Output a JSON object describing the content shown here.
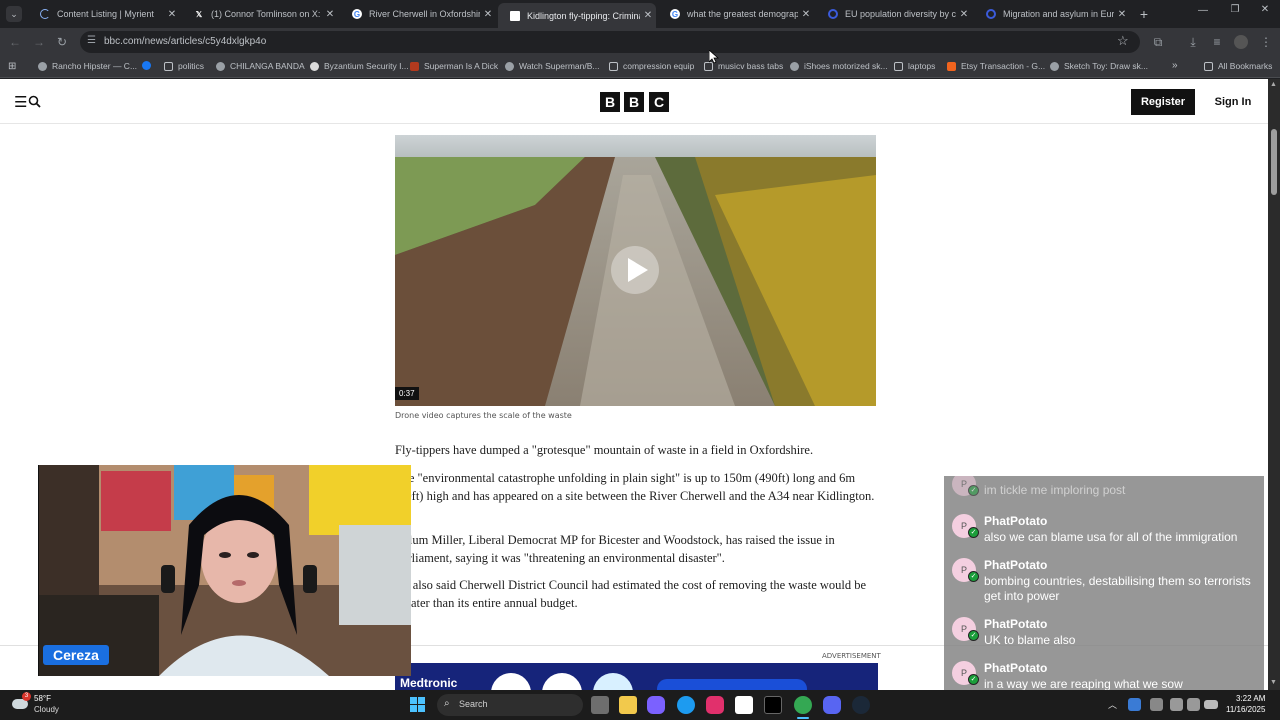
{
  "browser": {
    "tabs": [
      {
        "label": "Content Listing | Myrient"
      },
      {
        "label": "(1) Connor Tomlinson on X: \"A"
      },
      {
        "label": "River Cherwell in Oxfordshire"
      },
      {
        "label": "Kidlington fly-tipping: Criminal"
      },
      {
        "label": "what the greatest demographi"
      },
      {
        "label": "EU population diversity by citi"
      },
      {
        "label": "Migration and asylum in Europ"
      }
    ],
    "url": "bbc.com/news/articles/c5y4dxlgkp4o",
    "bookmarks": [
      {
        "label": "Rancho Hipster — C..."
      },
      {
        "label": ""
      },
      {
        "label": "politics"
      },
      {
        "label": "CHILANGA BANDA"
      },
      {
        "label": "Byzantium Security I..."
      },
      {
        "label": "Superman Is A Dick"
      },
      {
        "label": "Watch Superman/B..."
      },
      {
        "label": "compression equip"
      },
      {
        "label": "musicv bass tabs"
      },
      {
        "label": "iShoes motorized sk..."
      },
      {
        "label": "laptops"
      },
      {
        "label": "Etsy Transaction - G..."
      },
      {
        "label": "Sketch Toy: Draw sk..."
      },
      {
        "label": "All Bookmarks"
      }
    ]
  },
  "site": {
    "logo_letters": [
      "B",
      "B",
      "C"
    ],
    "register_label": "Register",
    "signin_label": "Sign In"
  },
  "article": {
    "video_duration": "0:37",
    "caption": "Drone video captures the scale of the waste",
    "paragraphs": [
      "Fly-tippers have dumped a \"grotesque\" mountain of waste in a field in Oxfordshire.",
      "The \"environmental catastrophe unfolding in plain sight\" is up to 150m (490ft) long and 6m (20ft) high and has appeared on a site between the River Cherwell and the A34 near Kidlington.",
      "Calum Miller, Liberal Democrat MP for Bicester and Woodstock, has raised the issue in Parliament, saying it was \"threatening an environmental disaster\".",
      "He also said Cherwell District Council had estimated the cost of removing the waste would be greater than its entire annual budget."
    ],
    "ad_label": "ADVERTISEMENT",
    "ad_brand": "Medtronic"
  },
  "stream": {
    "streamer_name": "Cereza",
    "chat": [
      {
        "user": "",
        "text": "im tickle me imploring post",
        "avatar": "P"
      },
      {
        "user": "PhatPotato",
        "text": "also we can blame usa for all of the immigration",
        "avatar": "P"
      },
      {
        "user": "PhatPotato",
        "text": "bombing countries, destabilising them so terrorists get into power",
        "avatar": "P"
      },
      {
        "user": "PhatPotato",
        "text": "UK to blame also",
        "avatar": "P"
      },
      {
        "user": "PhatPotato",
        "text": "in a way we are reaping what we sow",
        "avatar": "P"
      }
    ]
  },
  "taskbar": {
    "weather_temp": "58°F",
    "weather_desc": "Cloudy",
    "weather_badge": "3",
    "search_placeholder": "Search",
    "time": "3:22 AM",
    "date": "11/16/2025"
  },
  "colors": {
    "ad_blue": "#16247a",
    "chat_badge": "#1b9e3a",
    "name_tag": "#1a6fe0"
  }
}
